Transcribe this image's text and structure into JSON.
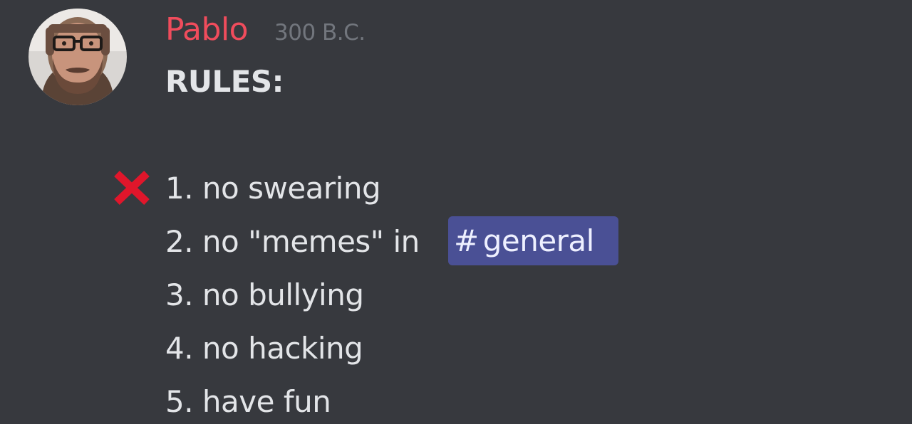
{
  "message": {
    "author": "Pablo",
    "timestamp": "300 B.C.",
    "title": "RULES:",
    "rules": [
      "1. no swearing",
      "2. no \"memes\" in",
      "3. no bullying",
      "4. no hacking",
      "5. have fun"
    ],
    "channel_mention": {
      "hash": "#",
      "name": "general"
    }
  },
  "reaction_icon": "cross-mark-icon",
  "colors": {
    "background": "#37393e",
    "author": "#f04c5c",
    "timestamp": "#72767d",
    "text": "#e3e5e8",
    "mention_bg": "#4a5095",
    "cross": "#e0162b"
  }
}
